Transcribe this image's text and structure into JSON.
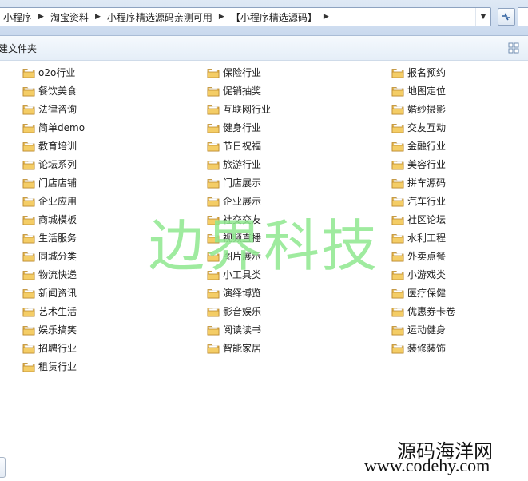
{
  "address": {
    "crumbs": [
      "小程序",
      "淘宝资料",
      "小程序精选源码亲测可用",
      "【小程序精选源码】"
    ]
  },
  "toolbar": {
    "new_folder_label": "建文件夹"
  },
  "folders": [
    [
      "o2o行业",
      "餐饮美食",
      "法律咨询",
      "简单demo",
      "教育培训",
      "论坛系列",
      "门店店铺",
      "企业应用",
      "商城模板",
      "生活服务",
      "同城分类",
      "物流快递",
      "新闻资讯",
      "艺术生活",
      "娱乐搞笑",
      "招聘行业",
      "租赁行业"
    ],
    [
      "保险行业",
      "促销抽奖",
      "互联网行业",
      "健身行业",
      "节日祝福",
      "旅游行业",
      "门店展示",
      "企业展示",
      "社交交友",
      "视频直播",
      "图片展示",
      "小工具类",
      "演绎博览",
      "影音娱乐",
      "阅读读书",
      "智能家居"
    ],
    [
      "报名预约",
      "地图定位",
      "婚纱摄影",
      "交友互动",
      "金融行业",
      "美容行业",
      "拼车源码",
      "汽车行业",
      "社区论坛",
      "水利工程",
      "外卖点餐",
      "小游戏类",
      "医疗保健",
      "优惠券卡卷",
      "运动健身",
      "装修装饰"
    ]
  ],
  "watermarks": {
    "center": "边界科技",
    "site_name": "源码海洋网",
    "site_url": "www.codehy.com"
  },
  "icons": {
    "folder": "folder-icon",
    "refresh": "refresh-icon",
    "views": "view-options-icon",
    "separator": "chevron-right-icon",
    "dropdown": "chevron-down-icon"
  }
}
